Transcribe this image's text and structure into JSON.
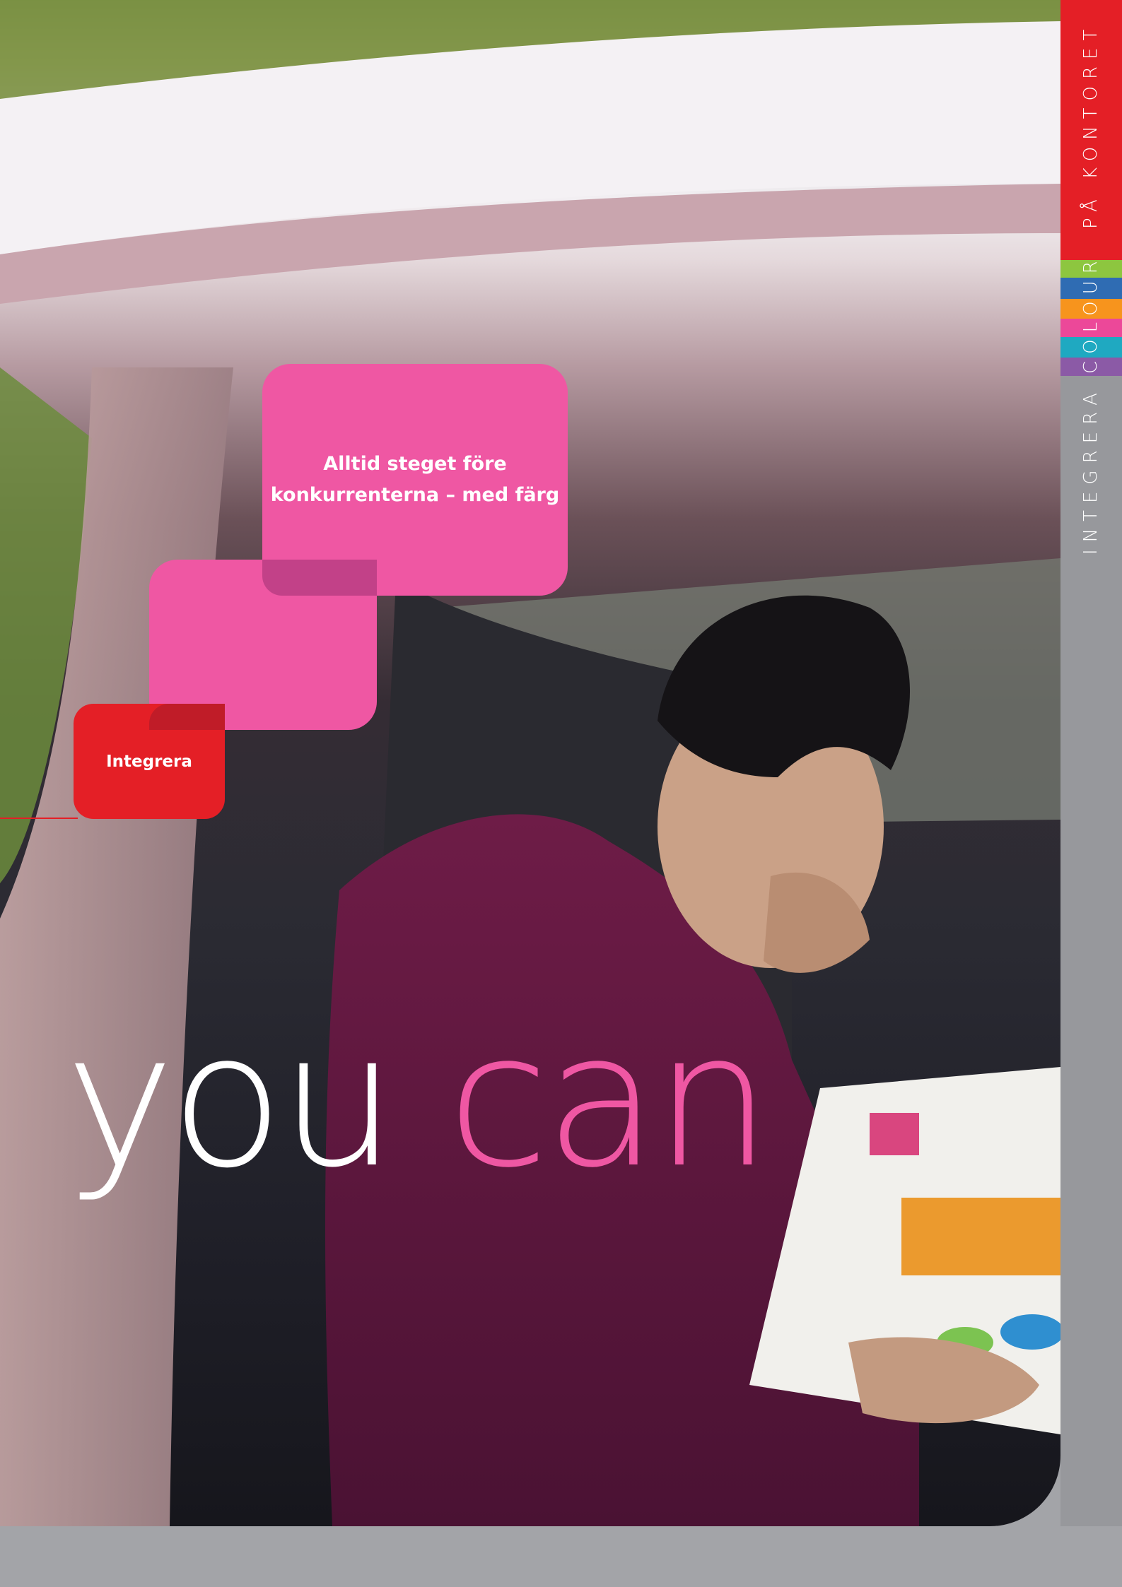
{
  "cover": {
    "tagline_line1": "Alltid steget före",
    "tagline_line2": "konkurrenterna – med färg",
    "section_label": "Integrera",
    "headline_word1": "you",
    "headline_word2": "can"
  },
  "side_strip": {
    "word_integrera": "INTEGRERA",
    "word_colour": "COLOUR",
    "word_kontoret": "PÅ KONTORET",
    "colors": [
      "#e41f26",
      "#8dc63f",
      "#2f6cb3",
      "#f7941d",
      "#ec4899",
      "#1fa9c1",
      "#8b5aa6",
      "#97989c"
    ]
  },
  "colors": {
    "pink": "#ef57a3",
    "red": "#e41f26",
    "gray": "#a3a4a8"
  }
}
